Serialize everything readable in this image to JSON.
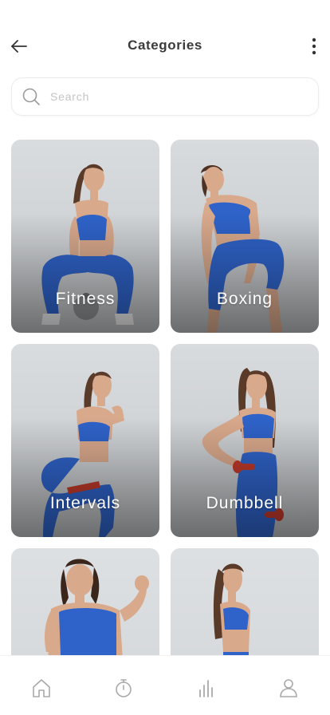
{
  "header": {
    "title": "Categories"
  },
  "search": {
    "placeholder": "Search",
    "value": ""
  },
  "categories": [
    {
      "label": "Fitness"
    },
    {
      "label": "Boxing"
    },
    {
      "label": "Intervals"
    },
    {
      "label": "Dumbbell"
    },
    {
      "label": ""
    },
    {
      "label": ""
    }
  ],
  "nav": [
    "home-icon",
    "stopwatch-icon",
    "stats-icon",
    "profile-icon"
  ],
  "colors": {
    "outfit": "#2f63c9",
    "skin": "#d9a98c",
    "hair": "#5a3a28",
    "label": "#ffffff",
    "icon": "#a9a9a9"
  }
}
